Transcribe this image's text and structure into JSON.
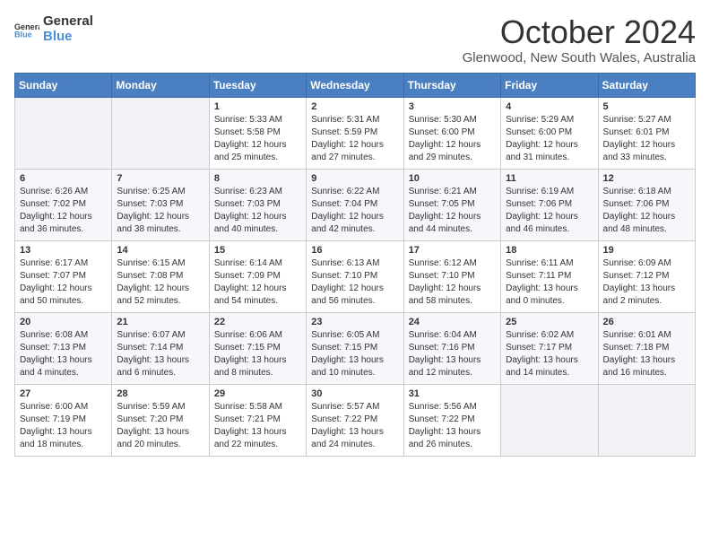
{
  "logo": {
    "general": "General",
    "blue": "Blue"
  },
  "title": "October 2024",
  "subtitle": "Glenwood, New South Wales, Australia",
  "days_header": [
    "Sunday",
    "Monday",
    "Tuesday",
    "Wednesday",
    "Thursday",
    "Friday",
    "Saturday"
  ],
  "weeks": [
    [
      {
        "day": "",
        "info": ""
      },
      {
        "day": "",
        "info": ""
      },
      {
        "day": "1",
        "info": "Sunrise: 5:33 AM\nSunset: 5:58 PM\nDaylight: 12 hours\nand 25 minutes."
      },
      {
        "day": "2",
        "info": "Sunrise: 5:31 AM\nSunset: 5:59 PM\nDaylight: 12 hours\nand 27 minutes."
      },
      {
        "day": "3",
        "info": "Sunrise: 5:30 AM\nSunset: 6:00 PM\nDaylight: 12 hours\nand 29 minutes."
      },
      {
        "day": "4",
        "info": "Sunrise: 5:29 AM\nSunset: 6:00 PM\nDaylight: 12 hours\nand 31 minutes."
      },
      {
        "day": "5",
        "info": "Sunrise: 5:27 AM\nSunset: 6:01 PM\nDaylight: 12 hours\nand 33 minutes."
      }
    ],
    [
      {
        "day": "6",
        "info": "Sunrise: 6:26 AM\nSunset: 7:02 PM\nDaylight: 12 hours\nand 36 minutes."
      },
      {
        "day": "7",
        "info": "Sunrise: 6:25 AM\nSunset: 7:03 PM\nDaylight: 12 hours\nand 38 minutes."
      },
      {
        "day": "8",
        "info": "Sunrise: 6:23 AM\nSunset: 7:03 PM\nDaylight: 12 hours\nand 40 minutes."
      },
      {
        "day": "9",
        "info": "Sunrise: 6:22 AM\nSunset: 7:04 PM\nDaylight: 12 hours\nand 42 minutes."
      },
      {
        "day": "10",
        "info": "Sunrise: 6:21 AM\nSunset: 7:05 PM\nDaylight: 12 hours\nand 44 minutes."
      },
      {
        "day": "11",
        "info": "Sunrise: 6:19 AM\nSunset: 7:06 PM\nDaylight: 12 hours\nand 46 minutes."
      },
      {
        "day": "12",
        "info": "Sunrise: 6:18 AM\nSunset: 7:06 PM\nDaylight: 12 hours\nand 48 minutes."
      }
    ],
    [
      {
        "day": "13",
        "info": "Sunrise: 6:17 AM\nSunset: 7:07 PM\nDaylight: 12 hours\nand 50 minutes."
      },
      {
        "day": "14",
        "info": "Sunrise: 6:15 AM\nSunset: 7:08 PM\nDaylight: 12 hours\nand 52 minutes."
      },
      {
        "day": "15",
        "info": "Sunrise: 6:14 AM\nSunset: 7:09 PM\nDaylight: 12 hours\nand 54 minutes."
      },
      {
        "day": "16",
        "info": "Sunrise: 6:13 AM\nSunset: 7:10 PM\nDaylight: 12 hours\nand 56 minutes."
      },
      {
        "day": "17",
        "info": "Sunrise: 6:12 AM\nSunset: 7:10 PM\nDaylight: 12 hours\nand 58 minutes."
      },
      {
        "day": "18",
        "info": "Sunrise: 6:11 AM\nSunset: 7:11 PM\nDaylight: 13 hours\nand 0 minutes."
      },
      {
        "day": "19",
        "info": "Sunrise: 6:09 AM\nSunset: 7:12 PM\nDaylight: 13 hours\nand 2 minutes."
      }
    ],
    [
      {
        "day": "20",
        "info": "Sunrise: 6:08 AM\nSunset: 7:13 PM\nDaylight: 13 hours\nand 4 minutes."
      },
      {
        "day": "21",
        "info": "Sunrise: 6:07 AM\nSunset: 7:14 PM\nDaylight: 13 hours\nand 6 minutes."
      },
      {
        "day": "22",
        "info": "Sunrise: 6:06 AM\nSunset: 7:15 PM\nDaylight: 13 hours\nand 8 minutes."
      },
      {
        "day": "23",
        "info": "Sunrise: 6:05 AM\nSunset: 7:15 PM\nDaylight: 13 hours\nand 10 minutes."
      },
      {
        "day": "24",
        "info": "Sunrise: 6:04 AM\nSunset: 7:16 PM\nDaylight: 13 hours\nand 12 minutes."
      },
      {
        "day": "25",
        "info": "Sunrise: 6:02 AM\nSunset: 7:17 PM\nDaylight: 13 hours\nand 14 minutes."
      },
      {
        "day": "26",
        "info": "Sunrise: 6:01 AM\nSunset: 7:18 PM\nDaylight: 13 hours\nand 16 minutes."
      }
    ],
    [
      {
        "day": "27",
        "info": "Sunrise: 6:00 AM\nSunset: 7:19 PM\nDaylight: 13 hours\nand 18 minutes."
      },
      {
        "day": "28",
        "info": "Sunrise: 5:59 AM\nSunset: 7:20 PM\nDaylight: 13 hours\nand 20 minutes."
      },
      {
        "day": "29",
        "info": "Sunrise: 5:58 AM\nSunset: 7:21 PM\nDaylight: 13 hours\nand 22 minutes."
      },
      {
        "day": "30",
        "info": "Sunrise: 5:57 AM\nSunset: 7:22 PM\nDaylight: 13 hours\nand 24 minutes."
      },
      {
        "day": "31",
        "info": "Sunrise: 5:56 AM\nSunset: 7:22 PM\nDaylight: 13 hours\nand 26 minutes."
      },
      {
        "day": "",
        "info": ""
      },
      {
        "day": "",
        "info": ""
      }
    ]
  ]
}
